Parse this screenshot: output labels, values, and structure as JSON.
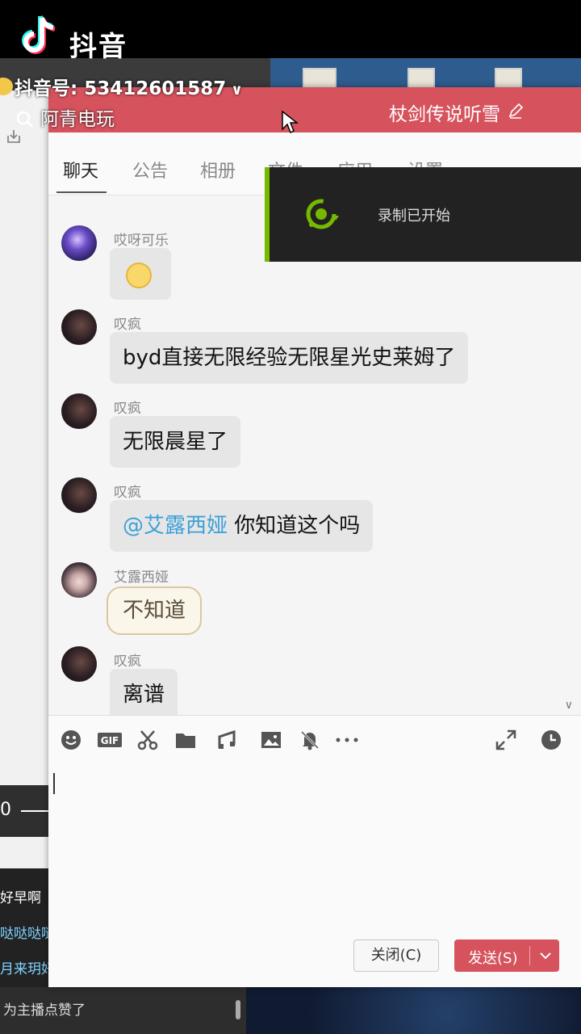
{
  "app": {
    "name": "抖音",
    "account": "抖音号: 53412601587",
    "search_text": "阿青电玩"
  },
  "window": {
    "group_name": "杖剑传说听雪",
    "tabs": [
      {
        "label": "聊天",
        "active": true
      },
      {
        "label": "公告"
      },
      {
        "label": "相册"
      },
      {
        "label": "文件"
      },
      {
        "label": "应用"
      },
      {
        "label": "设置"
      }
    ],
    "messages": [
      {
        "nick": "哎呀可乐",
        "type": "sticker"
      },
      {
        "nick": "叹疯",
        "text": "byd直接无限经验无限星光史莱姆了"
      },
      {
        "nick": "叹疯",
        "text": "无限晨星了"
      },
      {
        "nick": "叹疯",
        "mention": "@艾露西娅",
        "text": " 你知道这个吗"
      },
      {
        "nick": "艾露西娅",
        "text": "不知道"
      },
      {
        "nick": "叹疯",
        "text": "离谱"
      }
    ],
    "buttons": {
      "close": "关闭(C)",
      "send": "发送(S)"
    }
  },
  "toast": {
    "text": "录制已开始"
  },
  "left_panel": {
    "zero": "0",
    "chat_lines": [
      "好早啊",
      "哒哒哒哒",
      "月来玥好"
    ],
    "bottom_text": "为主播点赞了"
  },
  "colors": {
    "accent": "#d6535d",
    "mention": "#3aa0d8",
    "record": "#76b900"
  }
}
